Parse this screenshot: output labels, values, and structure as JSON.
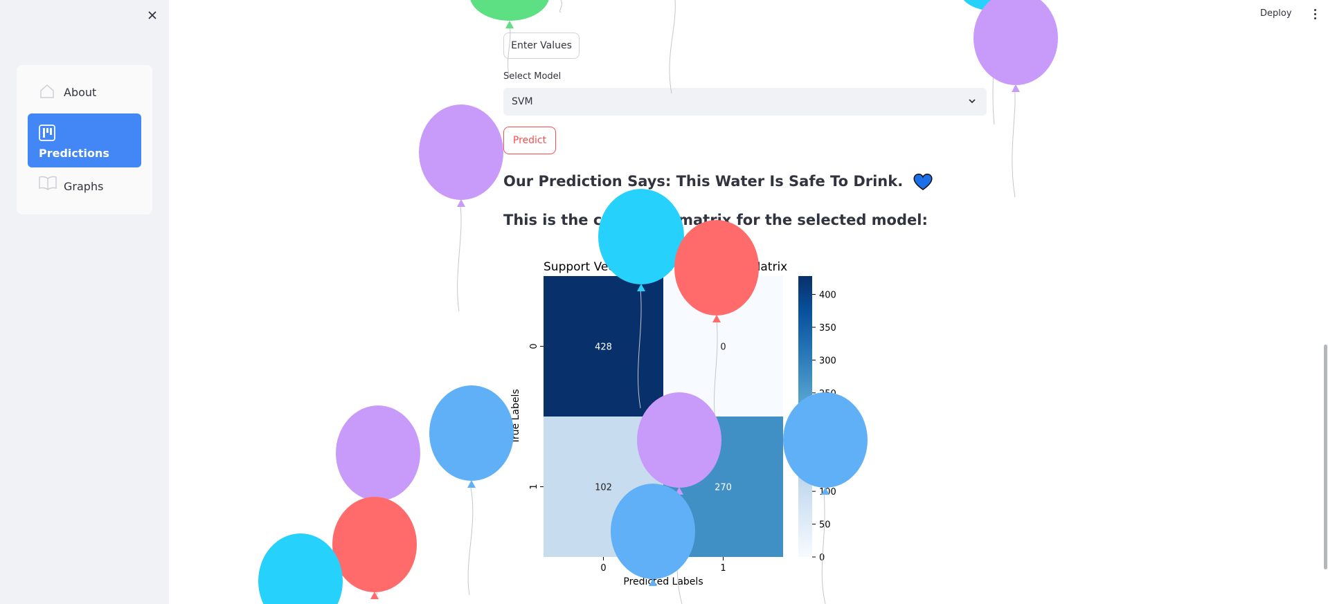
{
  "sidebar": {
    "items": [
      {
        "label": "About",
        "icon": "house-icon"
      },
      {
        "label": "Predictions",
        "icon": "chart-icon",
        "active": true
      },
      {
        "label": "Graphs",
        "icon": "book-icon"
      }
    ]
  },
  "header": {
    "deploy_label": "Deploy"
  },
  "main": {
    "enter_values_label": "Enter Values",
    "select_model_label": "Select Model",
    "selected_model": "SVM",
    "predict_label": "Predict",
    "prediction_text": "Our Prediction Says: This Water Is Safe To Drink.",
    "confusion_text": "This is the confusion matrix for the selected model:"
  },
  "chart_data": {
    "type": "heatmap",
    "title": "Support Vector Machine Confusion Matrix",
    "xlabel": "Predicted Labels",
    "ylabel": "True Labels",
    "x_categories": [
      "0",
      "1"
    ],
    "y_categories": [
      "0",
      "1"
    ],
    "values": [
      [
        428,
        0
      ],
      [
        102,
        270
      ]
    ],
    "colorbar": {
      "min": 0,
      "max": 428,
      "ticks": [
        0,
        50,
        100,
        150,
        200,
        250,
        300,
        350,
        400
      ]
    },
    "colormap": "Blues"
  },
  "colors": {
    "accent": "#4287f5",
    "primary": "#ff4b4b",
    "heart": "#1a6fe6"
  }
}
